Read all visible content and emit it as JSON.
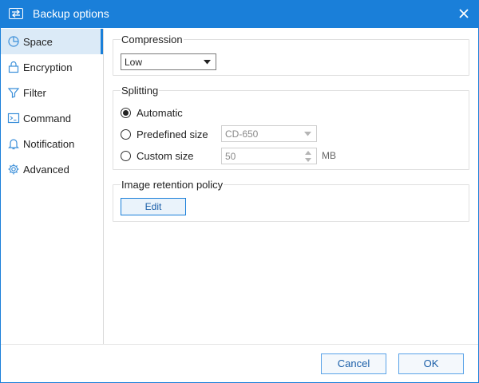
{
  "window": {
    "title": "Backup options"
  },
  "sidebar": {
    "items": [
      {
        "label": "Space",
        "icon": "pie-chart-icon",
        "active": true
      },
      {
        "label": "Encryption",
        "icon": "lock-icon",
        "active": false
      },
      {
        "label": "Filter",
        "icon": "filter-icon",
        "active": false
      },
      {
        "label": "Command",
        "icon": "terminal-icon",
        "active": false
      },
      {
        "label": "Notification",
        "icon": "bell-icon",
        "active": false
      },
      {
        "label": "Advanced",
        "icon": "gear-icon",
        "active": false
      }
    ]
  },
  "compression": {
    "title": "Compression",
    "selected": "Low"
  },
  "splitting": {
    "title": "Splitting",
    "automatic_label": "Automatic",
    "predefined_label": "Predefined size",
    "predefined_value": "CD-650",
    "custom_label": "Custom size",
    "custom_value": "50",
    "unit": "MB",
    "selected": "Automatic"
  },
  "retention": {
    "title": "Image retention policy",
    "edit_label": "Edit"
  },
  "footer": {
    "cancel_label": "Cancel",
    "ok_label": "OK"
  },
  "colors": {
    "accent": "#1a7fd9",
    "active_bg": "#dbeaf7"
  }
}
